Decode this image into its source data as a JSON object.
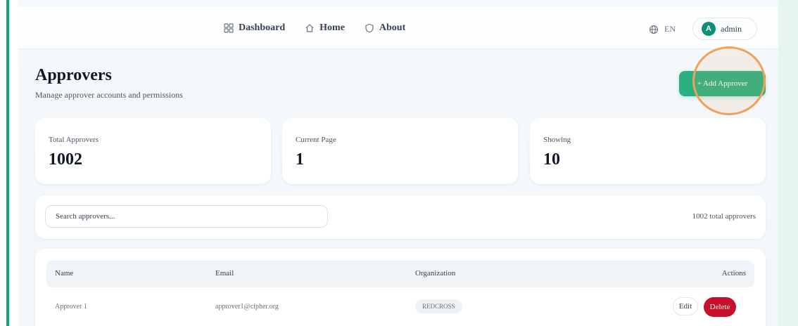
{
  "nav": {
    "items": [
      {
        "label": "Dashboard",
        "icon": "grid-icon"
      },
      {
        "label": "Home",
        "icon": "home-icon"
      },
      {
        "label": "About",
        "icon": "shield-icon"
      }
    ],
    "language": "EN",
    "user": {
      "initial": "A",
      "name": "admin"
    }
  },
  "page": {
    "title": "Approvers",
    "subtitle": "Manage approver accounts and permissions",
    "add_button": "+ Add Approver"
  },
  "stats": [
    {
      "label": "Total Approvers",
      "value": "1002"
    },
    {
      "label": "Current Page",
      "value": "1"
    },
    {
      "label": "Showing",
      "value": "10"
    }
  ],
  "search": {
    "placeholder": "Search approvers...",
    "total_label": "1002 total approvers"
  },
  "table": {
    "columns": [
      "Name",
      "Email",
      "Organization",
      "Actions"
    ],
    "rows": [
      {
        "name": "Approver 1",
        "email": "approver1@cipher.org",
        "organization": "REDCROSS",
        "edit": "Edit",
        "delete": "Delete"
      }
    ]
  },
  "colors": {
    "accent": "#2bb181",
    "danger": "#c8102e",
    "highlight": "#f0a05a"
  }
}
